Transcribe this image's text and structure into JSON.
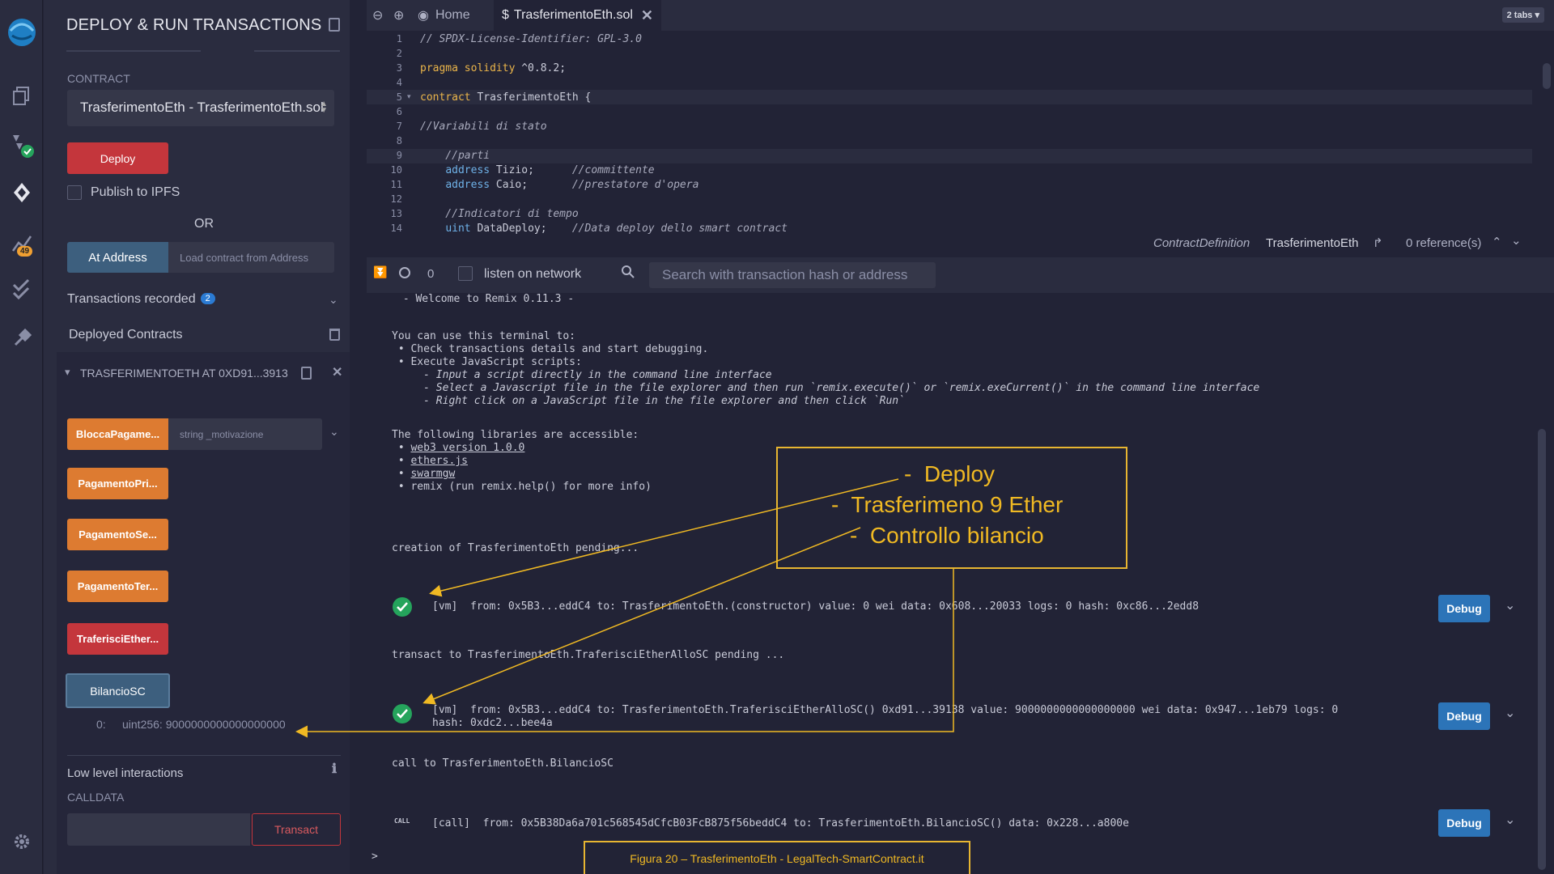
{
  "sidebar": {
    "badges": {
      "analysis": "49"
    }
  },
  "panel": {
    "title": "DEPLOY & RUN TRANSACTIONS",
    "contract_label": "CONTRACT",
    "contract_value": "TrasferimentoEth - TrasferimentoEth.sol",
    "deploy_label": "Deploy",
    "publish_label": "Publish to IPFS",
    "or_label": "OR",
    "at_address_label": "At Address",
    "at_address_placeholder": "Load contract from Address",
    "tx_recorded_label": "Transactions recorded",
    "tx_recorded_count": "2",
    "deployed_label": "Deployed Contracts",
    "instance_label": "TRASFERIMENTOETH AT 0XD91...3913",
    "functions": [
      {
        "label": "BloccaPagame...",
        "param": "string _motivazione"
      },
      {
        "label": "PagamentoPri..."
      },
      {
        "label": "PagamentoSe..."
      },
      {
        "label": "PagamentoTer..."
      },
      {
        "label": "TraferisciEther..."
      },
      {
        "label": "BilancioSC"
      }
    ],
    "result_index": "0:",
    "result_value": "uint256: 9000000000000000000",
    "low_level_label": "Low level interactions",
    "calldata_label": "CALLDATA",
    "transact_label": "Transact"
  },
  "tabs": {
    "home_label": "Home",
    "file_label": "TrasferimentoEth.sol",
    "count_label": "2 tabs"
  },
  "editor": {
    "line_numbers": [
      "1",
      "2",
      "3",
      "4",
      "5",
      "6",
      "7",
      "8",
      "9",
      "10",
      "11",
      "12",
      "13",
      "14"
    ],
    "l1": "// SPDX-License-Identifier: GPL-3.0",
    "l3_kw": "pragma solidity",
    "l3_rest": " ^0.8.2;",
    "l5_kw": "contract",
    "l5_rest": " TrasferimentoEth {",
    "l7": "//Variabili di stato",
    "l9": "    //parti",
    "l10_kw": "address",
    "l10_rest": " Tizio;      ",
    "l10_cm": "//committente",
    "l11_kw": "address",
    "l11_rest": " Caio;       ",
    "l11_cm": "//prestatore d'opera",
    "l13": "    //Indicatori di tempo",
    "l14_kw": "uint",
    "l14_rest": " DataDeploy;    ",
    "l14_cm": "//Data deploy dello smart contract"
  },
  "definition": {
    "kind": "ContractDefinition",
    "name": "TrasferimentoEth",
    "refs": "0 reference(s)"
  },
  "terminal": {
    "pending_count": "0",
    "listen_label": "listen on network",
    "search_placeholder": "Search with transaction hash or address",
    "welcome": " - Welcome to Remix 0.11.3 -",
    "intro": "You can use this terminal to:",
    "b1": " • Check transactions details and start debugging.",
    "b2": " • Execute JavaScript scripts:",
    "s1": "     - Input a script directly in the command line interface",
    "s2": "     - Select a Javascript file in the file explorer and then run `remix.execute()` or `remix.exeCurrent()` in the command line interface",
    "s3": "     - Right click on a JavaScript file in the file explorer and then click `Run`",
    "libs_intro": "The following libraries are accessible:",
    "lib1": "web3 version 1.0.0",
    "lib2": "ethers.js",
    "lib3": "swarmgw",
    "lib4": " • remix (run remix.help() for more info)",
    "creation": "creation of TrasferimentoEth pending...",
    "tx1": "[vm]  from: 0x5B3...eddC4 to: TrasferimentoEth.(constructor) value: 0 wei data: 0x608...20033 logs: 0 hash: 0xc86...2edd8",
    "transact_pending": "transact to TrasferimentoEth.TraferisciEtherAlloSC pending ...",
    "tx2_line1": "[vm]  from: 0x5B3...eddC4 to: TrasferimentoEth.TraferisciEtherAlloSC() 0xd91...39138 value: 9000000000000000000 wei data: 0x947...1eb79 logs: 0",
    "tx2_line2": "hash: 0xdc2...bee4a",
    "call_to": "call to TrasferimentoEth.BilancioSC",
    "call_tag": "CALL",
    "tx3": "[call]  from: 0x5B38Da6a701c568545dCfcB03FcB875f56beddC4 to: TrasferimentoEth.BilancioSC() data: 0x228...a800e",
    "debug_label": "Debug",
    "prompt": ">"
  },
  "annotations": {
    "line1": "-  Deploy",
    "line2": "-  Trasferimeno 9 Ether",
    "line3": "-  Controllo bilancio",
    "caption": "Figura 20 – TrasferimentoEth - LegalTech-SmartContract.it",
    "color": "#f0b923"
  },
  "colors": {
    "accent_red": "#c4363c",
    "accent_orange": "#dd7b31",
    "debug_blue": "#2c74b8",
    "success_green": "#25a45c"
  }
}
